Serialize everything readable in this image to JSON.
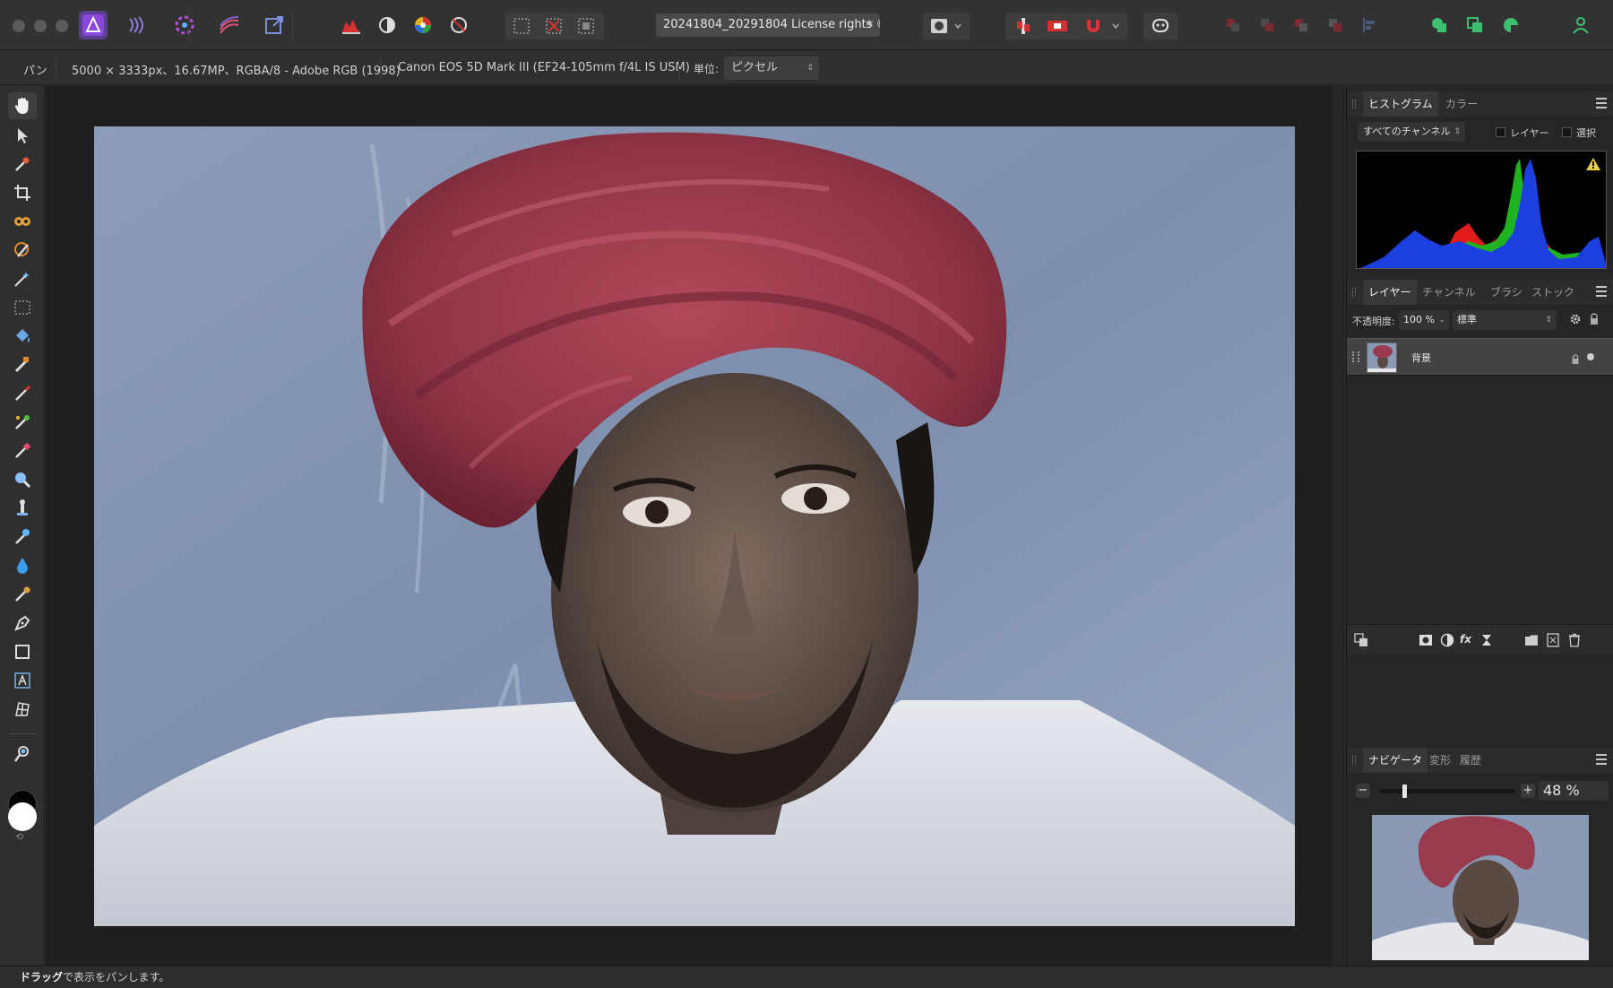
{
  "titlebar": {
    "document_title": "20241804_20291804 License rights ©",
    "doc_title_suffix": "✶"
  },
  "contextbar": {
    "tool_name": "パン",
    "image_info": "5000 × 3333px、16.67MP、RGBA/8 - Adobe RGB (1998)",
    "camera_info": "Canon EOS 5D Mark III (EF24-105mm f/4L IS USM)",
    "unit_label": "単位:",
    "unit_value": "ピクセル"
  },
  "histogram_panel": {
    "tabs": [
      "ヒストグラム",
      "カラー"
    ],
    "channel_select": "すべてのチャンネル",
    "checkbox_layer": "レイヤー",
    "checkbox_selection": "選択"
  },
  "layers_panel": {
    "tabs": [
      "レイヤー",
      "チャンネル",
      "ブラシ",
      "ストック"
    ],
    "opacity_label": "不透明度:",
    "opacity_value": "100 %",
    "blend_mode": "標準",
    "layers": [
      {
        "name": "背景"
      }
    ]
  },
  "navigator_panel": {
    "tabs": [
      "ナビゲータ",
      "変形",
      "履歴"
    ],
    "zoom_value": "48 %",
    "zoom_level": 0.48
  },
  "statusbar": {
    "bold_text": "ドラッグ",
    "text": "で表示をパンします。"
  },
  "colors": {
    "accent": "#7a3fd0",
    "histogram_red": "#e21b1b",
    "histogram_green": "#1fb31f",
    "histogram_blue": "#1c3fe0"
  },
  "tools": [
    "pan-tool",
    "move-tool",
    "color-picker-tool",
    "crop-tool",
    "red-eye-tool",
    "selection-brush-tool",
    "flood-select-tool",
    "rectangular-marquee-tool",
    "flood-fill-tool",
    "paint-brush-tool",
    "pixel-tool",
    "smudge-tool",
    "erase-tool",
    "zoom-view-tool",
    "clone-tool",
    "dodge-tool",
    "blur-tool",
    "retouch-tool",
    "pen-tool",
    "rectangle-tool",
    "artistic-text-tool",
    "mesh-warp-tool",
    "view-tool"
  ]
}
